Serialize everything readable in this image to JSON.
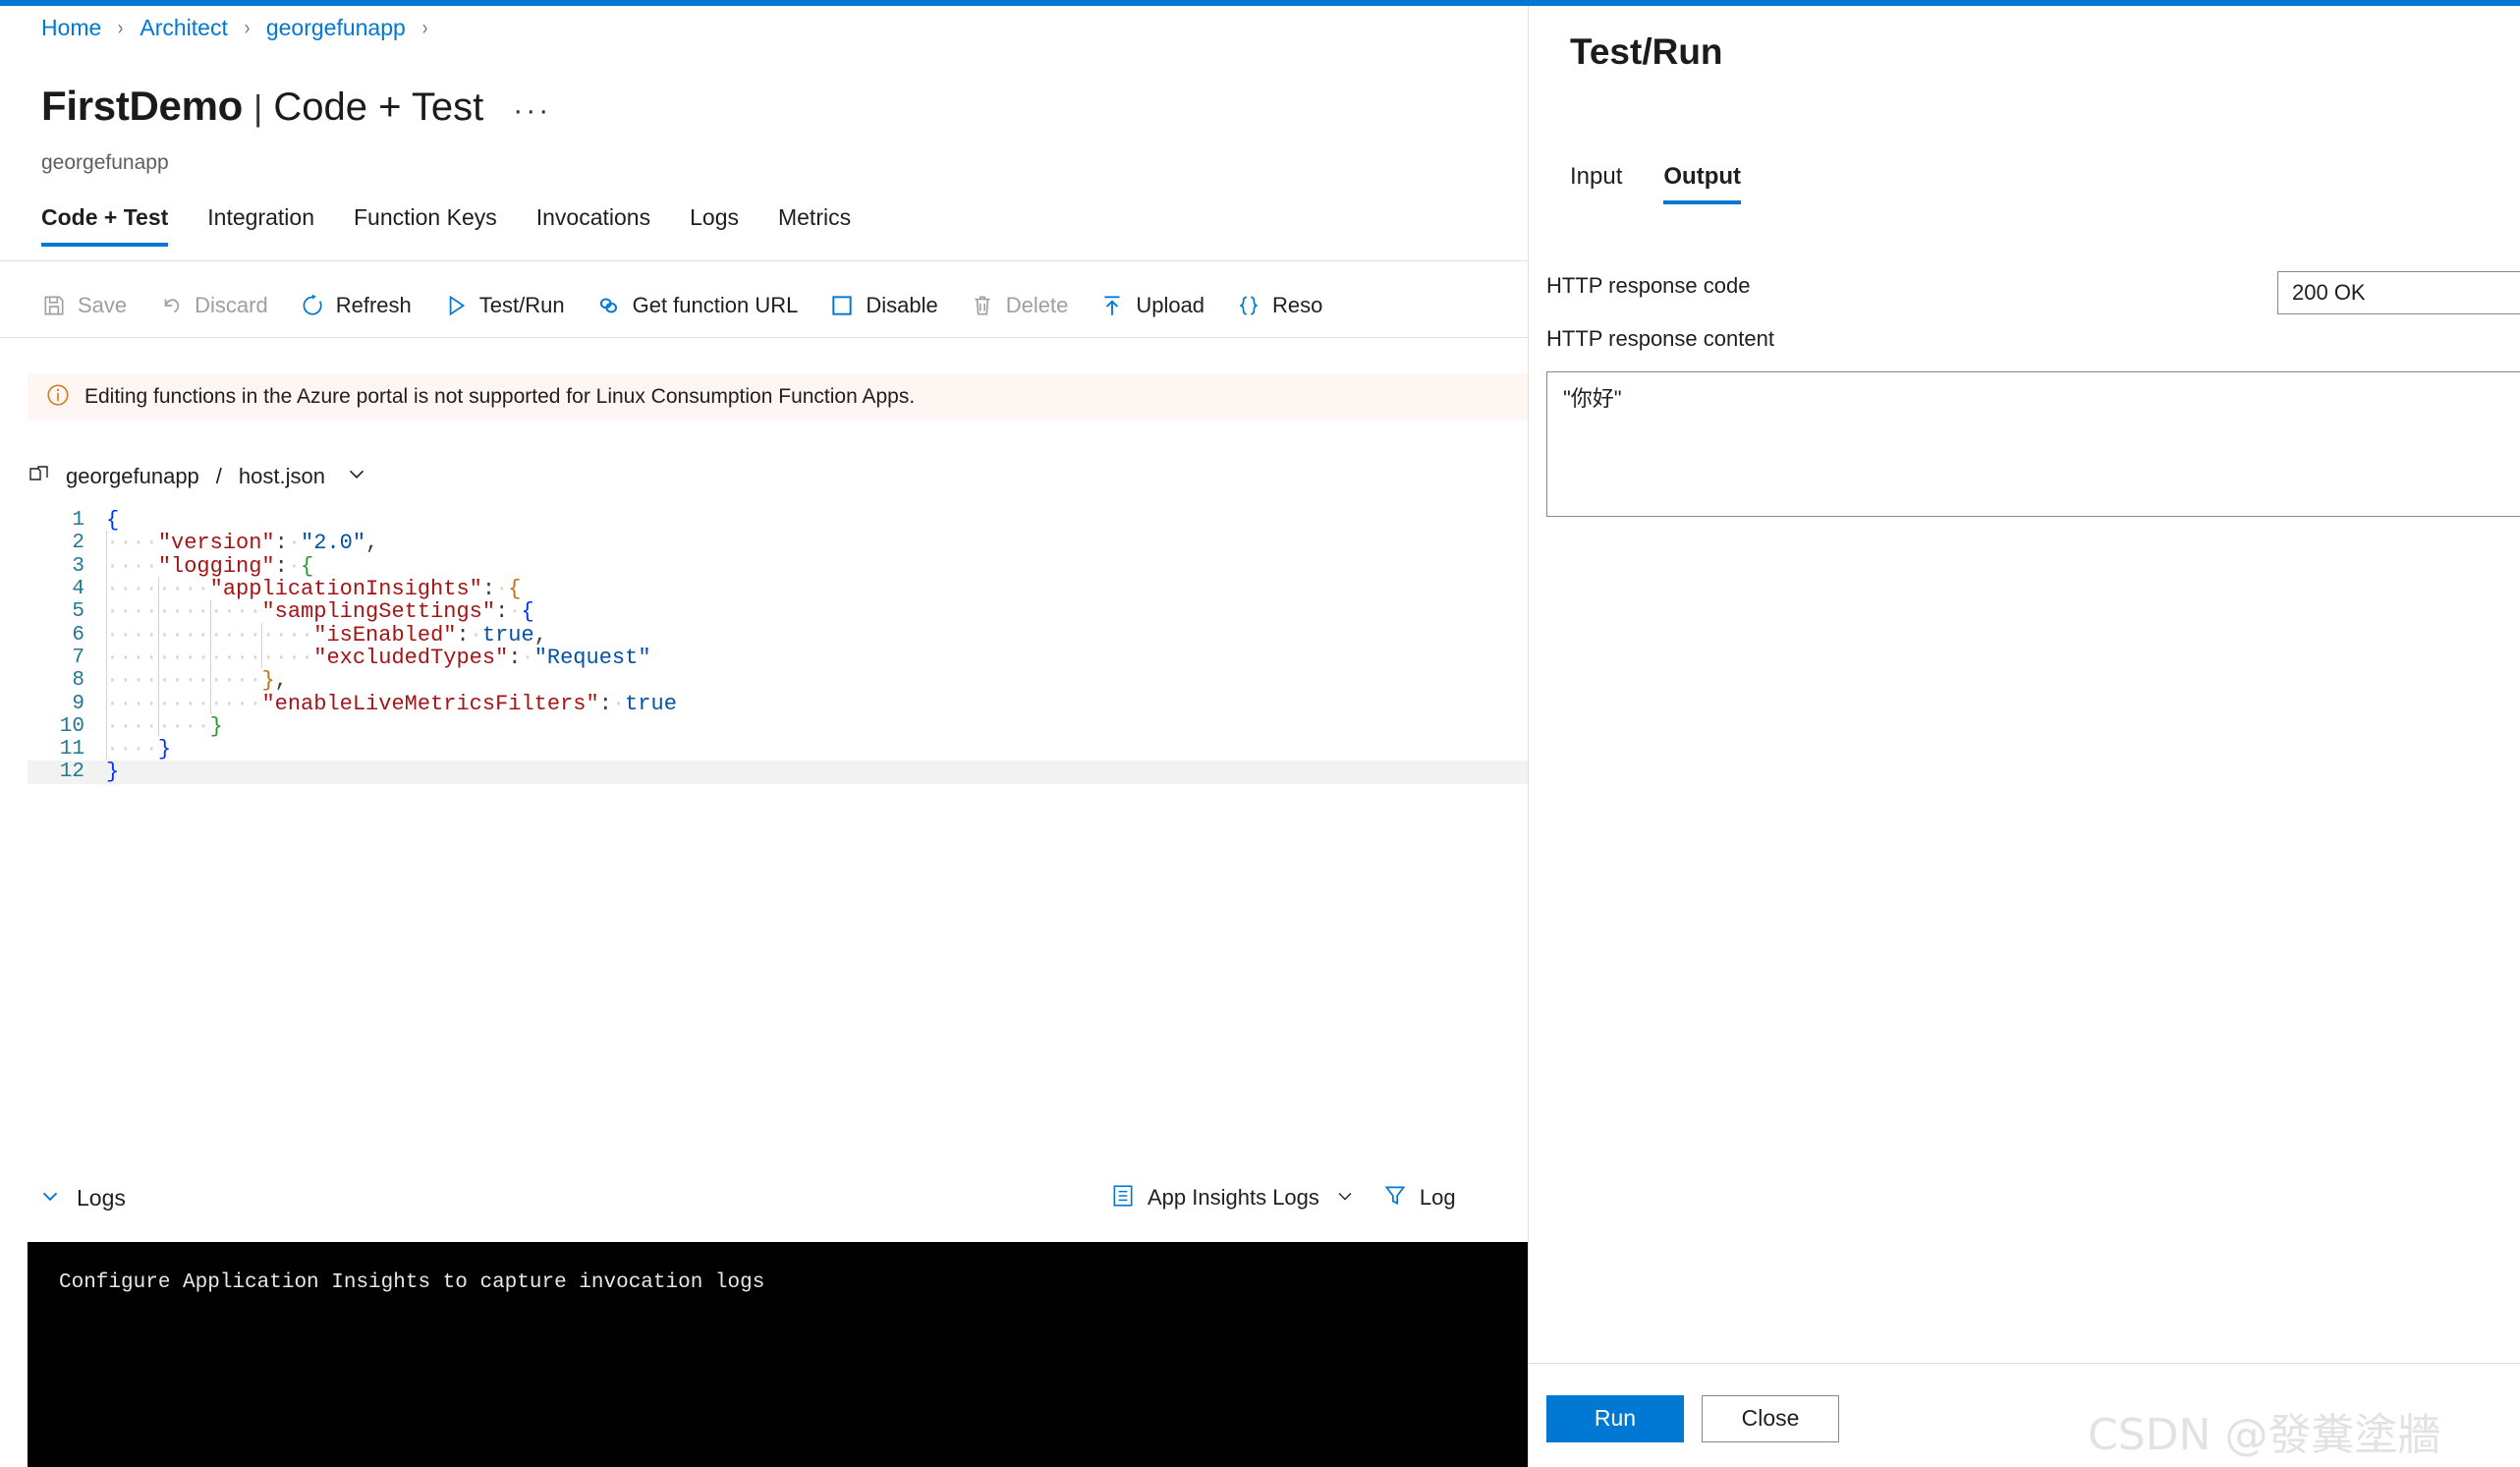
{
  "breadcrumb": {
    "items": [
      "Home",
      "Architect",
      "georgefunapp"
    ],
    "separator": "›"
  },
  "header": {
    "title": "FirstDemo",
    "separator": "|",
    "subtitle_section": "Code + Test",
    "ellipsis": "···",
    "resource_name": "georgefunapp"
  },
  "tabs": [
    {
      "label": "Code + Test",
      "active": true
    },
    {
      "label": "Integration",
      "active": false
    },
    {
      "label": "Function Keys",
      "active": false
    },
    {
      "label": "Invocations",
      "active": false
    },
    {
      "label": "Logs",
      "active": false
    },
    {
      "label": "Metrics",
      "active": false
    }
  ],
  "commandbar": [
    {
      "label": "Save",
      "icon": "save-icon",
      "disabled": true
    },
    {
      "label": "Discard",
      "icon": "discard-icon",
      "disabled": true
    },
    {
      "label": "Refresh",
      "icon": "refresh-icon",
      "disabled": false
    },
    {
      "label": "Test/Run",
      "icon": "play-icon",
      "disabled": false
    },
    {
      "label": "Get function URL",
      "icon": "link-icon",
      "disabled": false
    },
    {
      "label": "Disable",
      "icon": "square-icon",
      "disabled": false
    },
    {
      "label": "Delete",
      "icon": "trash-icon",
      "disabled": true
    },
    {
      "label": "Upload",
      "icon": "upload-icon",
      "disabled": false
    },
    {
      "label": "Reso",
      "icon": "braces-icon",
      "disabled": false
    }
  ],
  "banner": {
    "icon": "info-icon",
    "text": "Editing functions in the Azure portal is not supported for Linux Consumption Function Apps.",
    "background": "#fdf6f2",
    "icon_color": "#d67c1c"
  },
  "filebar": {
    "icon": "folder-icon",
    "folder": "georgefunapp",
    "separator": "/",
    "file": "host.json",
    "chevron": "chevron-down-icon"
  },
  "editor": {
    "language": "json",
    "current_line": 12,
    "lines": [
      {
        "num": "1",
        "indent": 0,
        "content": "{"
      },
      {
        "num": "2",
        "indent": 1,
        "content": "\"version\": \"2.0\","
      },
      {
        "num": "3",
        "indent": 1,
        "content": "\"logging\": {"
      },
      {
        "num": "4",
        "indent": 2,
        "content": "\"applicationInsights\": {"
      },
      {
        "num": "5",
        "indent": 3,
        "content": "\"samplingSettings\": {"
      },
      {
        "num": "6",
        "indent": 4,
        "content": "\"isEnabled\": true,"
      },
      {
        "num": "7",
        "indent": 4,
        "content": "\"excludedTypes\": \"Request\""
      },
      {
        "num": "8",
        "indent": 3,
        "content": "},"
      },
      {
        "num": "9",
        "indent": 3,
        "content": "\"enableLiveMetricsFilters\": true"
      },
      {
        "num": "10",
        "indent": 2,
        "content": "}"
      },
      {
        "num": "11",
        "indent": 1,
        "content": "}"
      },
      {
        "num": "12",
        "indent": 0,
        "content": "}"
      }
    ],
    "raw": "{\n    \"version\": \"2.0\",\n    \"logging\": {\n        \"applicationInsights\": {\n            \"samplingSettings\": {\n                \"isEnabled\": true,\n                \"excludedTypes\": \"Request\"\n            },\n            \"enableLiveMetricsFilters\": true\n        }\n    }\n}"
  },
  "logs_section": {
    "toggle_label": "Logs",
    "chevron": "chevron-down-icon",
    "source_label": "App Insights Logs",
    "source_chevron": "chevron-down-icon",
    "filter_label": "Log",
    "filter_icon": "filter-icon",
    "console_text": "Configure Application Insights to capture invocation logs"
  },
  "panel": {
    "title": "Test/Run",
    "tabs": [
      {
        "label": "Input",
        "active": false
      },
      {
        "label": "Output",
        "active": true
      }
    ],
    "fields": {
      "response_code_label": "HTTP response code",
      "response_code_value": "200 OK",
      "response_content_label": "HTTP response content",
      "response_content_value": "\"你好\""
    },
    "footer": {
      "run_label": "Run",
      "close_label": "Close"
    }
  },
  "watermark": {
    "text": "CSDN @發糞塗牆"
  },
  "colors": {
    "accent": "#0078d4",
    "text": "#201f1e",
    "muted": "#605e5c",
    "disabled": "#a19f9d",
    "border": "#e1dfdd",
    "console_bg": "#000000"
  }
}
